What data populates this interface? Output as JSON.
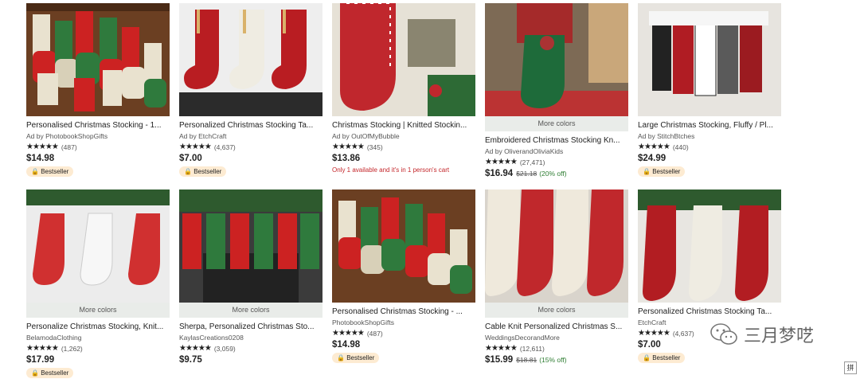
{
  "listings": [
    {
      "title": "Personalised Christmas Stocking - 1...",
      "shop": "Ad by PhotobookShopGifts",
      "stars": "★★★★★",
      "reviews": "(487)",
      "price": "$14.98",
      "badge": "Bestseller"
    },
    {
      "title": "Personalized Christmas Stocking Ta...",
      "shop": "Ad by EtchCraft",
      "stars": "★★★★★",
      "reviews": "(4,637)",
      "price": "$7.00",
      "badge": "Bestseller"
    },
    {
      "title": "Christmas Stocking | Knitted Stockin...",
      "shop": "Ad by OutOfMyBubble",
      "stars": "★★★★★",
      "reviews": "(345)",
      "price": "$13.86",
      "stock_note": "Only 1 available and it's in 1 person's cart"
    },
    {
      "more_colors": "More colors",
      "title": "Embroidered Christmas Stocking Kn...",
      "shop": "Ad by OliverandOliviaKids",
      "stars": "★★★★★",
      "reviews": "(27,471)",
      "price": "$16.94",
      "original_price": "$21.18",
      "discount": "(20% off)"
    },
    {
      "title": "Large Christmas Stocking, Fluffy / Pl...",
      "shop": "Ad by StitchBtches",
      "stars": "★★★★★",
      "reviews": "(440)",
      "price": "$24.99",
      "badge": "Bestseller"
    },
    {
      "more_colors": "More colors",
      "title": "Personalize Christmas Stocking, Knit...",
      "shop": "BelamodaClothing",
      "stars": "★★★★★",
      "reviews": "(1,262)",
      "price": "$17.99",
      "badge": "Bestseller"
    },
    {
      "more_colors": "More colors",
      "title": "Sherpa, Personalized Christmas Sto...",
      "shop": "KaylasCreations0208",
      "stars": "★★★★★",
      "reviews": "(3,059)",
      "price": "$9.75"
    },
    {
      "title": "Personalised Christmas Stocking - ...",
      "shop": "PhotobookShopGifts",
      "stars": "★★★★★",
      "reviews": "(487)",
      "price": "$14.98",
      "badge": "Bestseller"
    },
    {
      "more_colors": "More colors",
      "title": "Cable Knit Personalized Christmas S...",
      "shop": "WeddingsDecorandMore",
      "stars": "★★★★★",
      "reviews": "(12,611)",
      "price": "$15.99",
      "original_price": "$18.81",
      "discount": "(15% off)"
    },
    {
      "title": "Personalized Christmas Stocking Ta...",
      "shop": "EtchCraft",
      "stars": "★★★★★",
      "reviews": "(4,637)",
      "price": "$7.00",
      "badge": "Bestseller"
    }
  ],
  "watermark": {
    "text": "三月梦呓",
    "icon": "wechat-icon"
  },
  "corner_glyph": "拼",
  "colors": {
    "bestseller_bg": "#fdebd2",
    "discount": "#2e7d32",
    "stock_warning": "#c4272b"
  }
}
